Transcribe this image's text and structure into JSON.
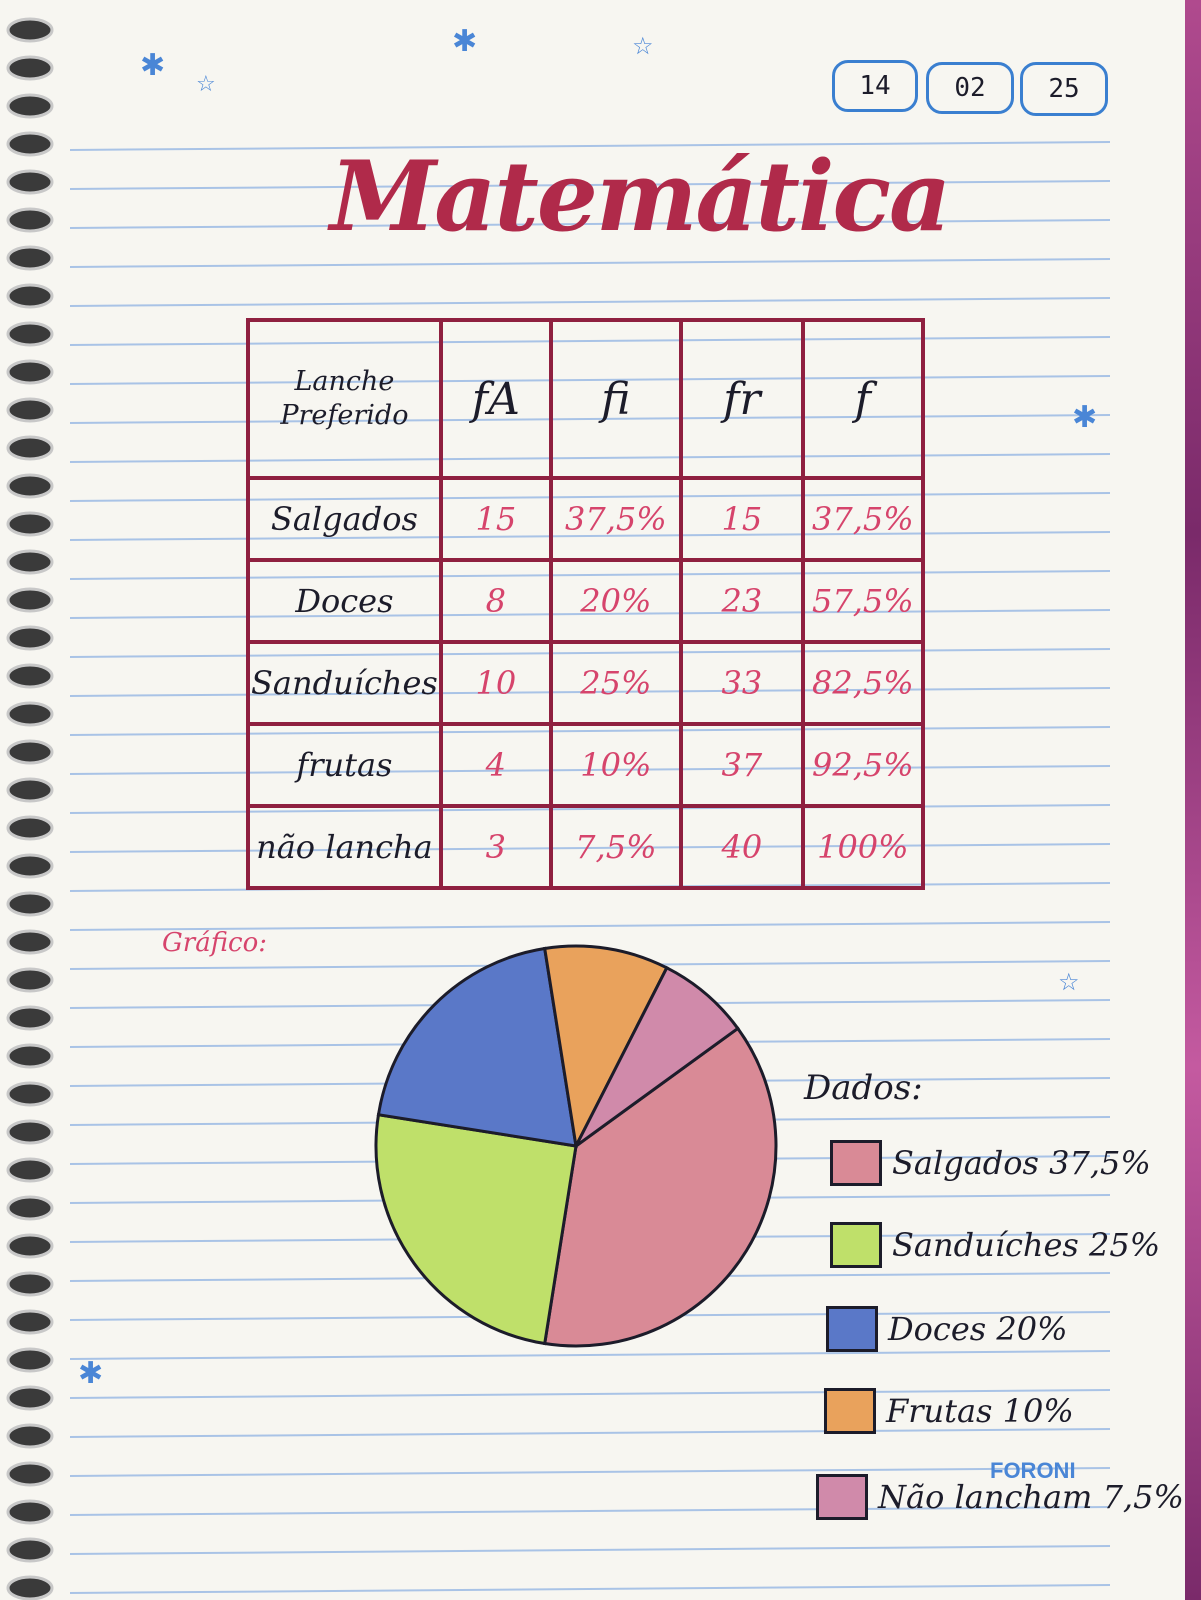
{
  "date": {
    "day": "14",
    "month": "02",
    "year": "25"
  },
  "title": "Matemática",
  "table": {
    "headers": [
      "Lanche Preferido",
      "fA",
      "fi",
      "fr",
      "f"
    ],
    "rows": [
      [
        "Salgados",
        "15",
        "37,5%",
        "15",
        "37,5%"
      ],
      [
        "Doces",
        "8",
        "20%",
        "23",
        "57,5%"
      ],
      [
        "Sanduíches",
        "10",
        "25%",
        "33",
        "82,5%"
      ],
      [
        "frutas",
        "4",
        "10%",
        "37",
        "92,5%"
      ],
      [
        "não lancha",
        "3",
        "7,5%",
        "40",
        "100%"
      ]
    ]
  },
  "grafico_label": "Gráfico:",
  "chart_data": {
    "type": "pie",
    "slices": [
      {
        "label": "Salgados",
        "value": 37.5,
        "color": "#d98a96"
      },
      {
        "label": "Sanduíches",
        "value": 25,
        "color": "#bfe06a"
      },
      {
        "label": "Doces",
        "value": 20,
        "color": "#5a78c8"
      },
      {
        "label": "Frutas",
        "value": 10,
        "color": "#e9a25c"
      },
      {
        "label": "Não lancham",
        "value": 7.5,
        "color": "#d08aaa"
      }
    ]
  },
  "legend": {
    "title": "Dados:",
    "items": [
      {
        "label": "Salgados 37,5%",
        "color": "#d98a96"
      },
      {
        "label": "Sanduíches 25%",
        "color": "#bfe06a"
      },
      {
        "label": "Doces 20%",
        "color": "#5a78c8"
      },
      {
        "label": "Frutas 10%",
        "color": "#e9a25c"
      },
      {
        "label": "Não lancham 7,5%",
        "color": "#d08aaa"
      }
    ]
  },
  "brand": "FORONI",
  "colors": {
    "ruling": "#a9c3e6",
    "table_border": "#8f2040",
    "ink_pink": "#d6446c",
    "ink_blue": "#3a7fd0"
  }
}
